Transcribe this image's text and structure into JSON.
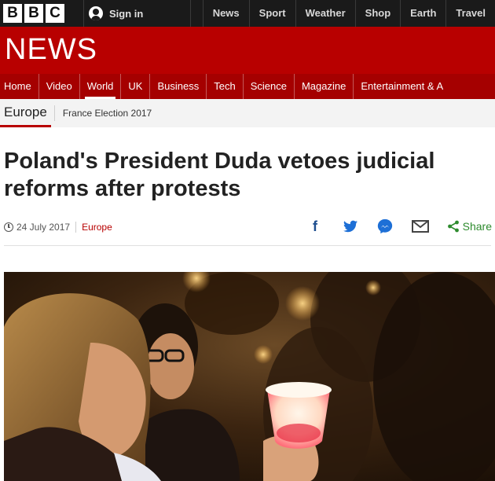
{
  "topbar": {
    "logo": [
      "B",
      "B",
      "C"
    ],
    "signin_label": "Sign in",
    "nav": [
      "News",
      "Sport",
      "Weather",
      "Shop",
      "Earth",
      "Travel"
    ]
  },
  "banner": {
    "title": "NEWS"
  },
  "section_nav": {
    "items": [
      "Home",
      "Video",
      "World",
      "UK",
      "Business",
      "Tech",
      "Science",
      "Magazine",
      "Entertainment & A"
    ],
    "active": "World"
  },
  "sub_nav": {
    "primary": "Europe",
    "secondary": "France Election 2017"
  },
  "article": {
    "headline": "Poland's President Duda vetoes judicial reforms after protests",
    "date": "24 July 2017",
    "section": "Europe"
  },
  "share": {
    "icons": [
      "facebook-icon",
      "twitter-icon",
      "messenger-icon",
      "email-icon",
      "share-icon"
    ],
    "label": "Share"
  },
  "colors": {
    "brand_red": "#b80000",
    "nav_red": "#a50000",
    "topbar": "#1a1a1a",
    "share_green": "#2e8b2e"
  }
}
